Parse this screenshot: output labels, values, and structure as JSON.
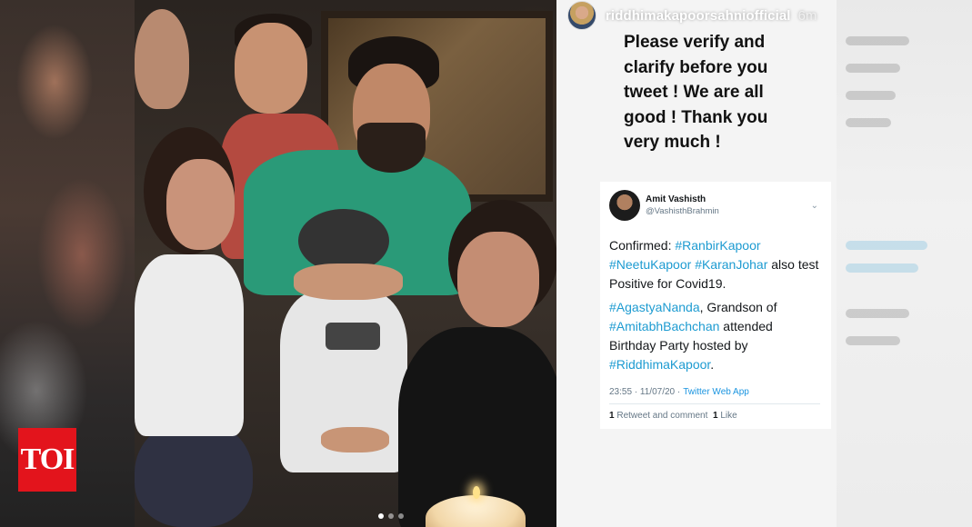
{
  "story": {
    "username": "riddhimakapoorsahniofficial",
    "time_ago": "6m",
    "message": "Please verify and clarify before you tweet ! We are all good ! Thank you very much !"
  },
  "tweet": {
    "author_name": "Amit Vashisth",
    "author_handle": "@VashisthBrahmin",
    "line1_prefix": "Confirmed: ",
    "line1_tags": [
      "#RanbirKapoor",
      "#NeetuKapoor",
      "#KaranJohar"
    ],
    "line1_suffix": " also test Positive for Covid19.",
    "line2_tag1": "#AgastyaNanda",
    "line2_mid": ", Grandson of ",
    "line2_tag2": "#AmitabhBachchan",
    "line2_mid2": " attended Birthday Party hosted by ",
    "line2_tag3": "#RiddhimaKapoor",
    "line2_end": ".",
    "timestamp": "23:55 · 11/07/20 ·",
    "client": "Twitter Web App",
    "retweets_count": "1",
    "retweets_label": "Retweet and comment",
    "likes_count": "1",
    "likes_label": "Like"
  },
  "logo": {
    "text": "TOI"
  },
  "carousel": {
    "active_index": 0,
    "total": 3
  }
}
